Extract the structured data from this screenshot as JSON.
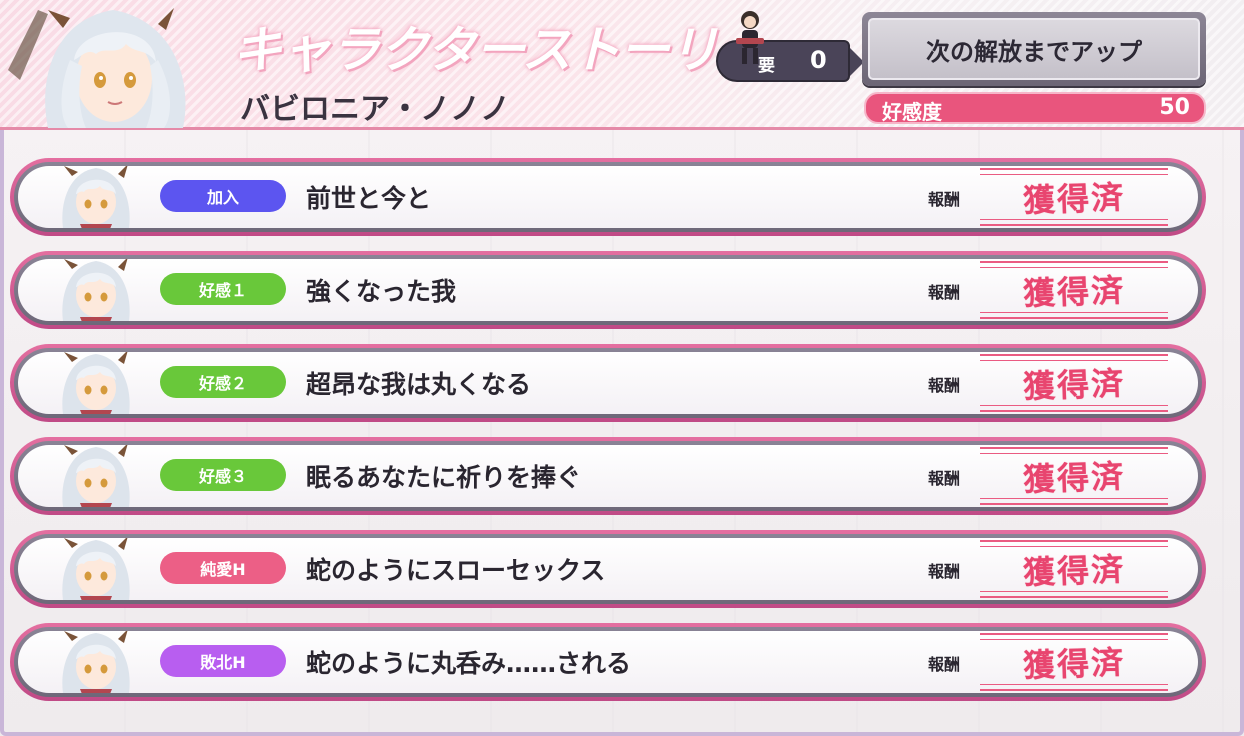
{
  "header": {
    "title": "キャラクターストーリー",
    "character_name": "バビロニア・ノノノ",
    "requirement_label": "要",
    "requirement_value": "0",
    "unlock_button_label": "次の解放までアップ",
    "affinity_label": "好感度",
    "affinity_value": "50"
  },
  "colors": {
    "badge_join": "#5c55f0",
    "badge_affinity": "#69c83a",
    "badge_pure_love": "#ec5f86",
    "badge_defeat": "#b85ef0",
    "accent_pink": "#e8456f"
  },
  "stories": [
    {
      "badge": "加入",
      "badge_type": "join",
      "title": "前世と今と",
      "reward_label": "報酬",
      "reward_status": "獲得済"
    },
    {
      "badge": "好感１",
      "badge_type": "affinity",
      "title": "強くなった我",
      "reward_label": "報酬",
      "reward_status": "獲得済"
    },
    {
      "badge": "好感２",
      "badge_type": "affinity",
      "title": "超昂な我は丸くなる",
      "reward_label": "報酬",
      "reward_status": "獲得済"
    },
    {
      "badge": "好感３",
      "badge_type": "affinity",
      "title": "眠るあなたに祈りを捧ぐ",
      "reward_label": "報酬",
      "reward_status": "獲得済"
    },
    {
      "badge": "純愛H",
      "badge_type": "pure_love",
      "title": "蛇のようにスローセックス",
      "reward_label": "報酬",
      "reward_status": "獲得済"
    },
    {
      "badge": "敗北H",
      "badge_type": "defeat",
      "title": "蛇のように丸呑み……される",
      "reward_label": "報酬",
      "reward_status": "獲得済"
    }
  ]
}
